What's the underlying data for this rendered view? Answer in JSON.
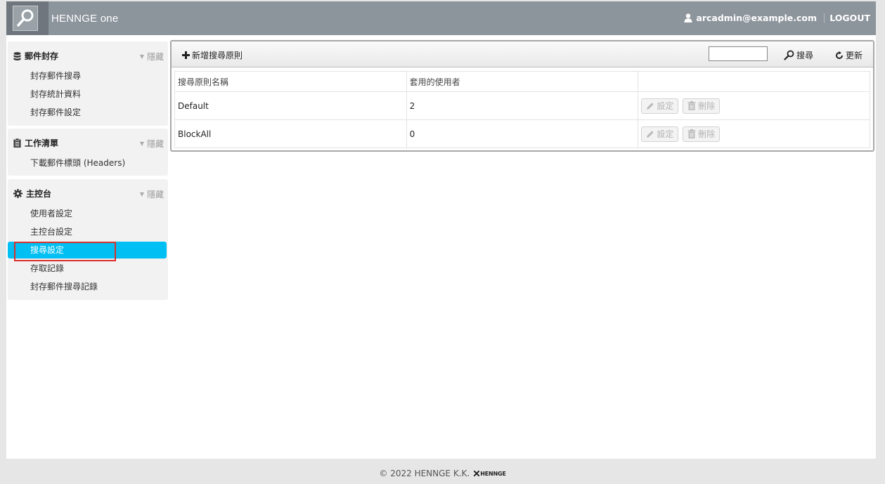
{
  "header": {
    "brand_prefix": "HENNGE",
    "brand_suffix": "one",
    "user": "arcadmin@example.com",
    "logout": "LOGOUT"
  },
  "sidebar": {
    "sections": [
      {
        "title": "郵件封存",
        "hide": "隱藏",
        "items": [
          "封存郵件搜尋",
          "封存統計資料",
          "封存郵件設定"
        ]
      },
      {
        "title": "工作清單",
        "hide": "隱藏",
        "items": [
          "下載郵件標頭 (Headers)"
        ]
      },
      {
        "title": "主控台",
        "hide": "隱藏",
        "items": [
          "使用者設定",
          "主控台設定",
          "搜尋設定",
          "存取記錄",
          "封存郵件搜尋記錄"
        ]
      }
    ]
  },
  "toolbar": {
    "add_label": "新增搜尋原則",
    "search_value": "",
    "search_label": "搜尋",
    "refresh_label": "更新"
  },
  "table": {
    "columns": [
      "搜尋原則名稱",
      "套用的使用者",
      ""
    ],
    "rows": [
      {
        "name": "Default",
        "users": "2",
        "edit": "設定",
        "delete": "刪除"
      },
      {
        "name": "BlockAll",
        "users": "0",
        "edit": "設定",
        "delete": "刪除"
      }
    ]
  },
  "footer": {
    "copyright": "© 2022 HENNGE K.K.",
    "mini_logo": "HENNGE"
  }
}
